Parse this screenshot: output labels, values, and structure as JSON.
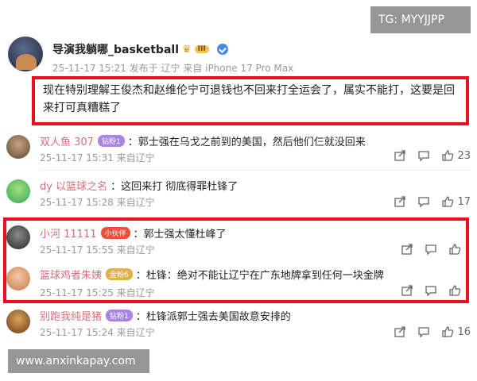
{
  "watermark_top": "TG: MYYJJPP",
  "watermark_bottom": "www.anxinkapay.com",
  "post": {
    "author": "导演我躺哪_basketball",
    "level_badge": "III",
    "meta": "25-11-17 15:21 发布于 辽宁 来自 iPhone 17 Pro Max",
    "body": "现在特别理解王俊杰和赵维伦宁可退钱也不回来打全运会了，属实不能打，这要是回来打可真糟糕了"
  },
  "comments": [
    {
      "name": "双人鱼 307",
      "badge": "钻粉1",
      "text": "：郭士强在乌戈之前到的美国，然后他们仨就没回来",
      "meta": "25-11-17 15:31 来自辽宁",
      "likes": "23"
    },
    {
      "name": "dy 以篮球之名",
      "badge": "",
      "text": "：这回来打 彻底得罪杜锋了",
      "meta": "25-11-17 15:28 来自辽宁",
      "likes": "17"
    },
    {
      "name": "小河 11111",
      "badge": "小伙伴",
      "text": "：郭士强太懂杜峰了",
      "meta": "25-11-17 15:55 来自辽宁",
      "likes": ""
    },
    {
      "name": "篮球鸡者朱姨",
      "badge": "金粉6",
      "text": "：杜锋：绝对不能让辽宁在广东地牌拿到任何一块金牌",
      "meta": "25-11-17 15:25 来自辽宁",
      "likes": ""
    },
    {
      "name": "别跑我纯是猪",
      "badge": "钻粉1",
      "text": "：杜锋派郭士强去美国故意安排的",
      "meta": "25-11-17 15:24 来自辽宁",
      "likes": "16"
    }
  ],
  "colors": {
    "highlight": "#e8101f",
    "username": "#d4707a",
    "meta": "#999999"
  }
}
